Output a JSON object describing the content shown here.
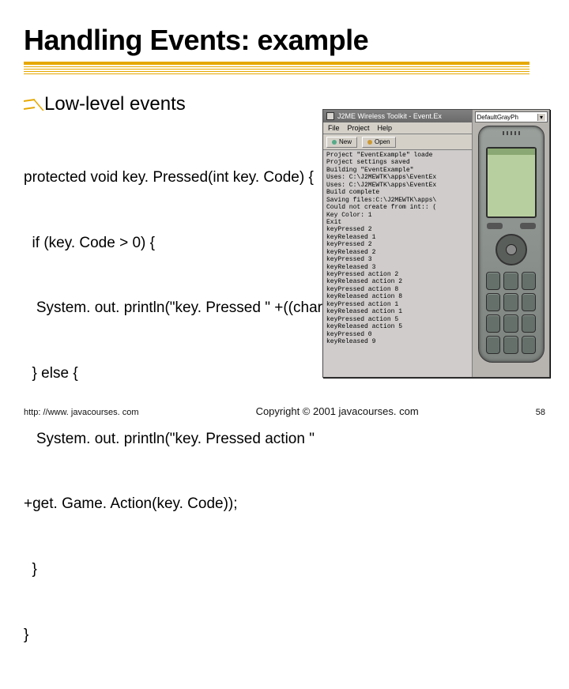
{
  "slide": {
    "title": "Handling Events: example",
    "bullet": "Low-level events",
    "code_lines": [
      "protected void key. Pressed(int key. Code) {",
      "  if (key. Code > 0) {",
      "   System. out. println(\"key. Pressed \" +((char)key. Code));",
      "  } else {",
      "   System. out. println(\"key. Pressed action \"",
      "+get. Game. Action(key. Code));",
      "  }",
      "}"
    ]
  },
  "emulator": {
    "title": "J2ME Wireless Toolkit - Event.Ex",
    "menu": {
      "file": "File",
      "project": "Project",
      "help": "Help"
    },
    "toolbar": {
      "new": "New",
      "open": "Open"
    },
    "device": "DefaultGrayPh",
    "console_lines": [
      "Project \"EventExample\" loade",
      "Project settings saved",
      "Building \"EventExample\"",
      "Uses: C:\\J2MEWTK\\apps\\EventEx",
      "Uses: C:\\J2MEWTK\\apps\\EventEx",
      "Build complete",
      "Saving files:C:\\J2MEWTK\\apps\\",
      "Could not create from int:: (",
      "Key Color: 1",
      "Exit",
      "keyPressed 2",
      "keyReleased 1",
      "keyPressed 2",
      "keyReleased 2",
      "keyPressed 3",
      "keyReleased 3",
      "keyPressed action 2",
      "keyReleased action 2",
      "keyPressed action 8",
      "keyReleased action 8",
      "keyPressed action 1",
      "keyReleased action 1",
      "keyPressed action 5",
      "keyReleased action 5",
      "keyPressed 0",
      "keyReleased 9"
    ]
  },
  "footer": {
    "url": "http: //www. javacourses. com",
    "copy": "Copyright © 2001 javacourses. com",
    "page": "58"
  }
}
